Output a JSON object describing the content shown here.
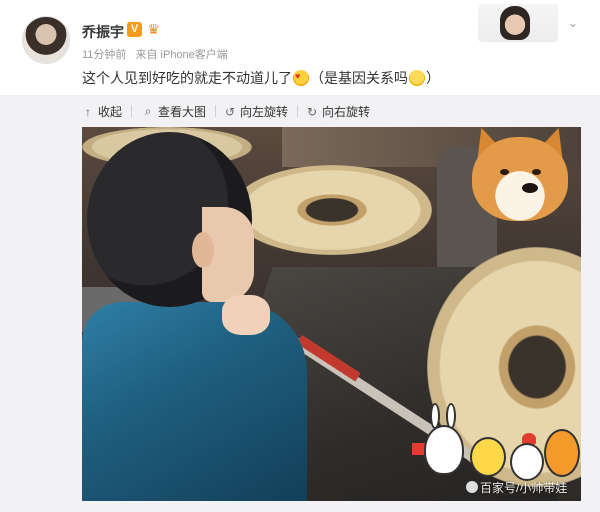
{
  "post": {
    "username": "乔振宇",
    "vip_badge": "V",
    "time": "11分钟前",
    "source": "来自 iPhone客户端",
    "text_before": "这个人见到好吃的就走不动道儿了",
    "text_middle": "（是基因关系吗",
    "text_after": "）",
    "icons": {
      "verified": "vip-v-icon",
      "crown": "crown-icon",
      "menu": "chevron-down-icon",
      "emoji_1": "love-face-emoji",
      "emoji_2": "doubt-face-emoji"
    }
  },
  "toolbar": {
    "collapse": "收起",
    "view_large": "查看大图",
    "rotate_left": "向左旋转",
    "rotate_right": "向右旋转"
  },
  "photo": {
    "watermark": "百家号/小帅带娃"
  },
  "colors": {
    "vip": "#f59a1b",
    "panel_bg": "#f2f2f5",
    "meta_text": "#999999"
  }
}
